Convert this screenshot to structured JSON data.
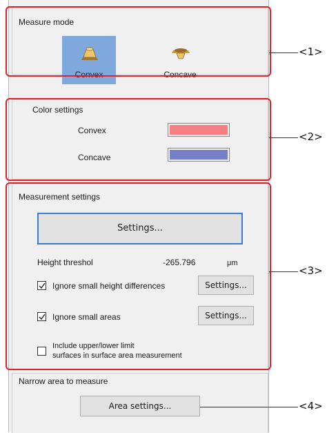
{
  "measure_mode": {
    "title": "Measure mode",
    "options": [
      {
        "label": "Convex",
        "selected": true,
        "icon": "convex-icon"
      },
      {
        "label": "Concave",
        "selected": false,
        "icon": "concave-icon"
      }
    ]
  },
  "color_settings": {
    "title": "Color settings",
    "convex_label": "Convex",
    "convex_color": "#f77f84",
    "concave_label": "Concave",
    "concave_color": "#7780c6"
  },
  "measurement_settings": {
    "title": "Measurement settings",
    "settings_button": "Settings...",
    "height_threshold_label": "Height threshol",
    "height_threshold_value": "-265.796",
    "height_threshold_unit": "μm",
    "ignore_height": {
      "label": "Ignore small height differences",
      "checked": true,
      "button": "Settings..."
    },
    "ignore_areas": {
      "label": "Ignore small areas",
      "checked": true,
      "button": "Settings..."
    },
    "include_limits": {
      "line1": "Include upper/lower limit",
      "line2": "surfaces in surface area measurement",
      "checked": false
    }
  },
  "narrow_area": {
    "title": "Narrow area to measure",
    "button": "Area settings..."
  },
  "callouts": [
    "<1>",
    "<2>",
    "<3>",
    "<4>"
  ],
  "colors": {
    "accent_red": "#e0212c",
    "selected_blue": "#7fa9dc",
    "focus_blue": "#3b7bd4"
  }
}
